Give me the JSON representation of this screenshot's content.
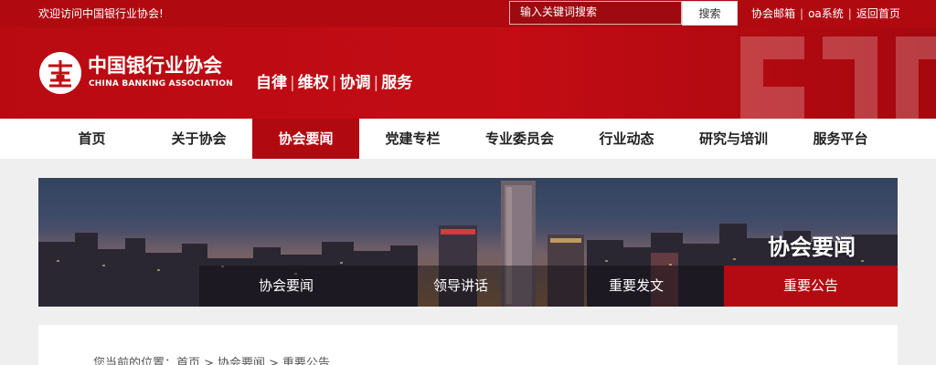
{
  "topbar": {
    "welcome": "欢迎访问中国银行业协会!",
    "search_placeholder": "输入关键词搜索",
    "search_button": "搜索",
    "links": [
      "协会邮箱",
      "oa系统",
      "返回首页"
    ]
  },
  "header": {
    "org_name_cn": "中国银行业协会",
    "org_name_en": "CHINA BANKING ASSOCIATION",
    "slogan": [
      "自律",
      "维权",
      "协调",
      "服务"
    ]
  },
  "nav": {
    "items": [
      "首页",
      "关于协会",
      "协会要闻",
      "党建专栏",
      "专业委员会",
      "行业动态",
      "研究与培训",
      "服务平台"
    ],
    "active": "协会要闻"
  },
  "banner": {
    "title": "协会要闻",
    "tabs": [
      "协会要闻",
      "领导讲话",
      "重要发文",
      "重要公告"
    ],
    "active_tab": "重要公告"
  },
  "breadcrumb": {
    "label": "您当前的位置：",
    "items": [
      "首页",
      "协会要闻",
      "重要公告"
    ]
  },
  "colors": {
    "brand_red": "#b00a10",
    "nav_active": "#b00a10",
    "background": "#efefef"
  }
}
